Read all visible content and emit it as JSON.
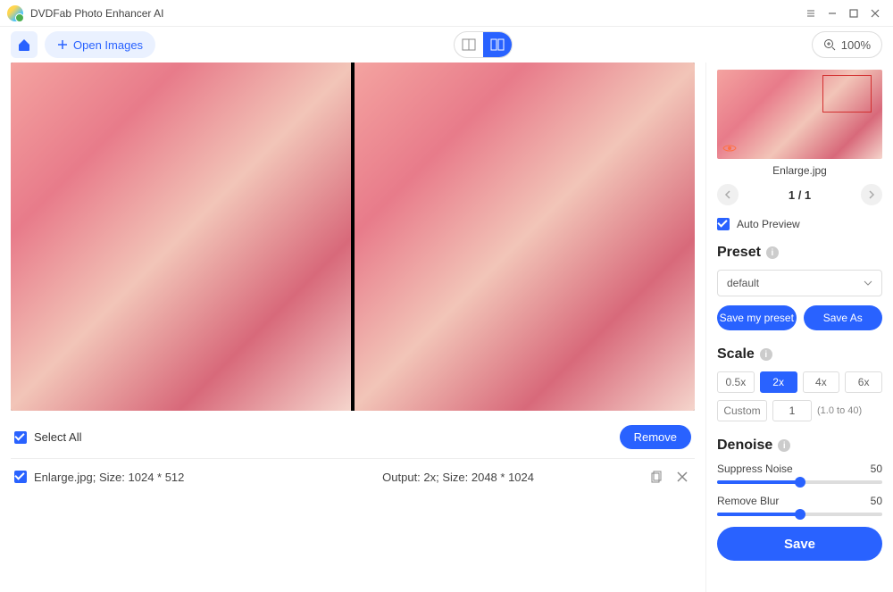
{
  "app": {
    "title": "DVDFab Photo Enhancer AI"
  },
  "toolbar": {
    "open_label": "Open Images",
    "zoom_label": "100%"
  },
  "list": {
    "select_all_label": "Select All",
    "remove_label": "Remove",
    "items": [
      {
        "info": "Enlarge.jpg; Size: 1024 * 512",
        "output": "Output: 2x; Size: 2048 * 1024"
      }
    ]
  },
  "side": {
    "filename": "Enlarge.jpg",
    "pager_current": "1",
    "pager_sep": " / ",
    "pager_total": "1",
    "auto_preview_label": "Auto Preview",
    "preset": {
      "title": "Preset",
      "value": "default",
      "save_my_preset": "Save my preset",
      "save_as": "Save As"
    },
    "scale": {
      "title": "Scale",
      "options": [
        "0.5x",
        "2x",
        "4x",
        "6x"
      ],
      "active": "2x",
      "custom_label": "Custom",
      "custom_value": "1",
      "range_hint": "(1.0 to 40)"
    },
    "denoise": {
      "title": "Denoise",
      "suppress_label": "Suppress Noise",
      "suppress_value": "50",
      "blur_label": "Remove Blur",
      "blur_value": "50"
    },
    "save_label": "Save"
  }
}
